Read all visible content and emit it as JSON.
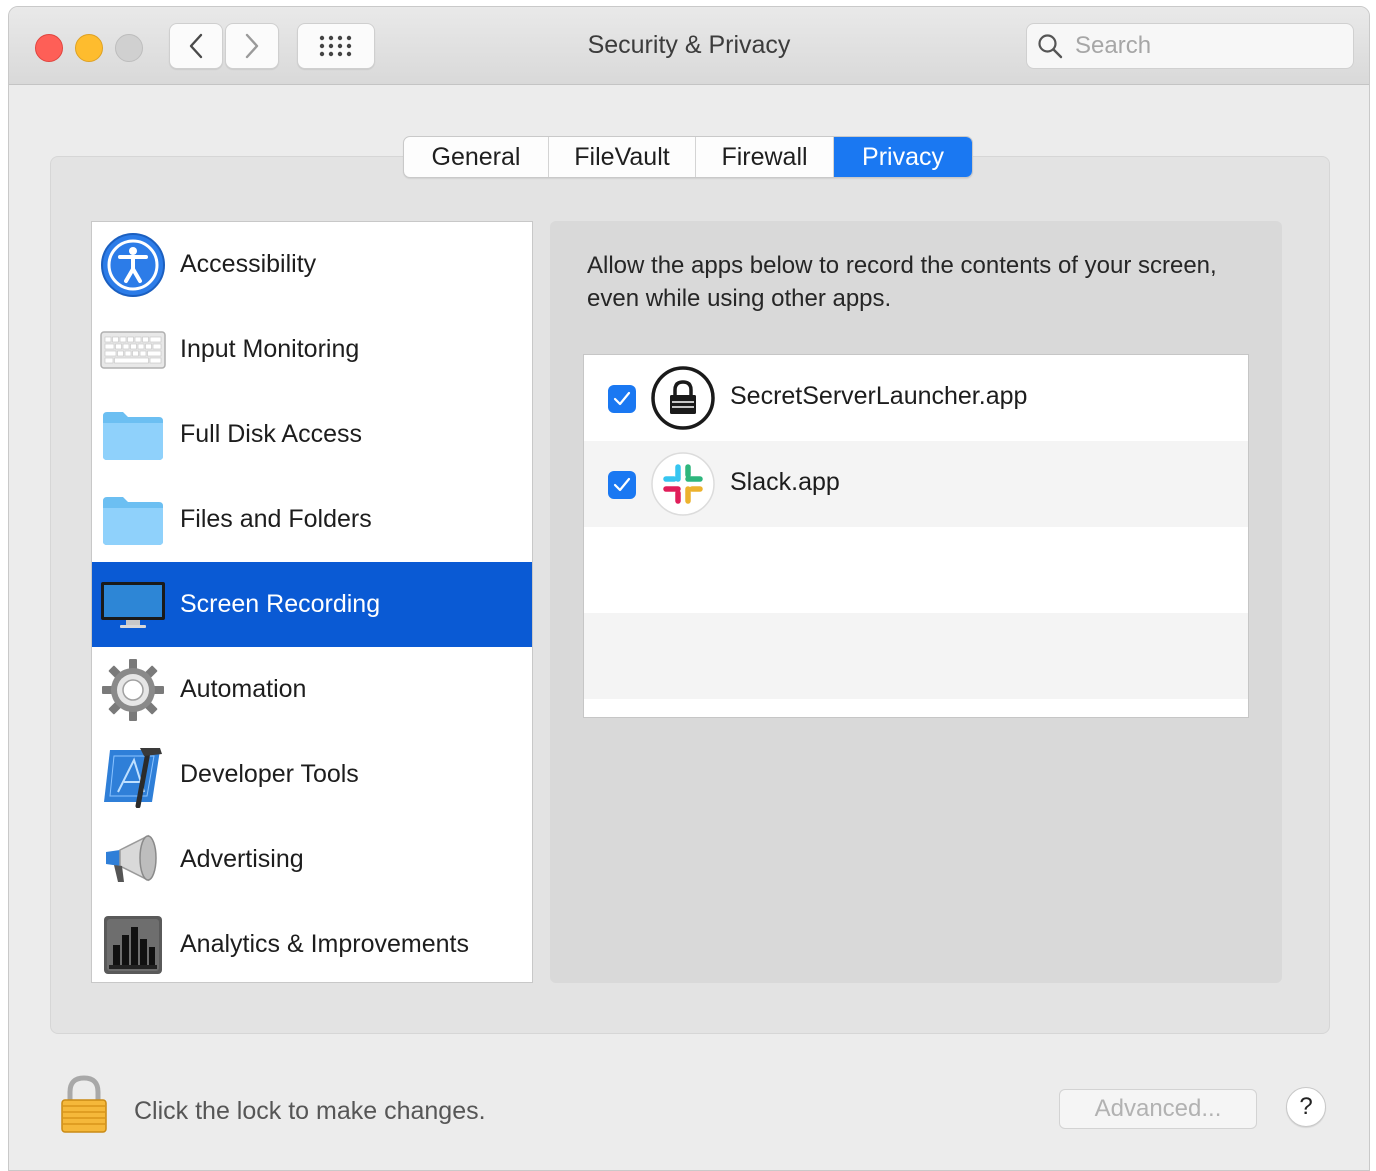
{
  "window": {
    "title": "Security & Privacy"
  },
  "search": {
    "placeholder": "Search"
  },
  "tabs": [
    {
      "label": "General",
      "active": false
    },
    {
      "label": "FileVault",
      "active": false
    },
    {
      "label": "Firewall",
      "active": false
    },
    {
      "label": "Privacy",
      "active": true
    }
  ],
  "sidebar": {
    "items": [
      {
        "label": "Accessibility",
        "icon": "accessibility-icon"
      },
      {
        "label": "Input Monitoring",
        "icon": "keyboard-icon"
      },
      {
        "label": "Full Disk Access",
        "icon": "folder-icon"
      },
      {
        "label": "Files and Folders",
        "icon": "folder-icon"
      },
      {
        "label": "Screen Recording",
        "icon": "display-icon",
        "selected": true
      },
      {
        "label": "Automation",
        "icon": "gear-icon"
      },
      {
        "label": "Developer Tools",
        "icon": "developer-tools-icon"
      },
      {
        "label": "Advertising",
        "icon": "megaphone-icon"
      },
      {
        "label": "Analytics & Improvements",
        "icon": "analytics-icon"
      }
    ]
  },
  "pane": {
    "description": "Allow the apps below to record the contents of your screen, even while using other apps.",
    "apps": [
      {
        "name": "SecretServerLauncher.app",
        "checked": true,
        "icon": "lock-circle-icon"
      },
      {
        "name": "Slack.app",
        "checked": true,
        "icon": "slack-icon"
      }
    ]
  },
  "footer": {
    "lock_text": "Click the lock to make changes.",
    "advanced_label": "Advanced...",
    "help_label": "?"
  },
  "colors": {
    "accent": "#1a78f2",
    "selection": "#0a5ad4",
    "close": "#fe5f57",
    "minimize": "#febc2e"
  }
}
